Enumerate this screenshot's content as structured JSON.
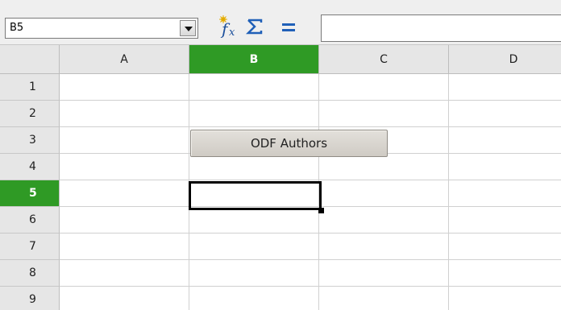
{
  "formula_bar": {
    "name_box_value": "B5",
    "icons": [
      "function-wizard-icon",
      "sum-icon",
      "equals-icon"
    ],
    "formula_value": ""
  },
  "sheet": {
    "columns": [
      "A",
      "B",
      "C",
      "D"
    ],
    "rows": [
      "1",
      "2",
      "3",
      "4",
      "5",
      "6",
      "7",
      "8",
      "9"
    ],
    "selected_column": "B",
    "selected_row": "5",
    "selected_cell": "B5"
  },
  "form_button": {
    "label": "ODF Authors"
  },
  "colors": {
    "selection_header": "#2f9a25",
    "header_background": "#e6e6e6",
    "grid_line": "#d0d0d0",
    "button_background": "#d6d2cb"
  }
}
